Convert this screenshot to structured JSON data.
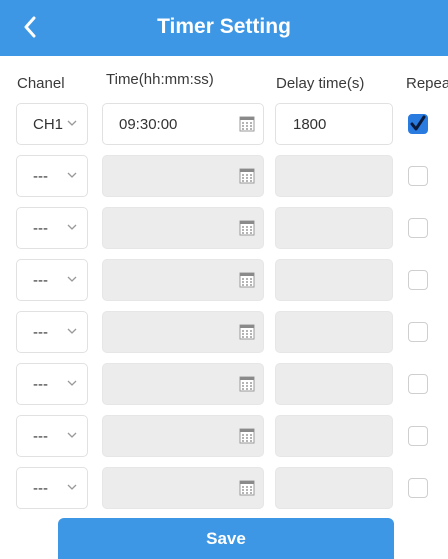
{
  "header": {
    "title": "Timer Setting",
    "back_icon": "chevron-left-icon",
    "color": "#3d97e4"
  },
  "columns": {
    "channel": "Chanel",
    "time": "Time(hh:mm:ss)",
    "delay": "Delay time(s)",
    "repeat": "Repeat"
  },
  "rows": [
    {
      "channel": "CH1",
      "time": "09:30:00",
      "delay": "1800",
      "repeat": true,
      "enabled": true
    },
    {
      "channel": "---",
      "time": "",
      "delay": "",
      "repeat": false,
      "enabled": false
    },
    {
      "channel": "---",
      "time": "",
      "delay": "",
      "repeat": false,
      "enabled": false
    },
    {
      "channel": "---",
      "time": "",
      "delay": "",
      "repeat": false,
      "enabled": false
    },
    {
      "channel": "---",
      "time": "",
      "delay": "",
      "repeat": false,
      "enabled": false
    },
    {
      "channel": "---",
      "time": "",
      "delay": "",
      "repeat": false,
      "enabled": false
    },
    {
      "channel": "---",
      "time": "",
      "delay": "",
      "repeat": false,
      "enabled": false
    },
    {
      "channel": "---",
      "time": "",
      "delay": "",
      "repeat": false,
      "enabled": false
    }
  ],
  "icons": {
    "calendar": "calendar-icon",
    "dropdown": "chevron-down-icon",
    "check": "checkmark-icon"
  },
  "footer": {
    "save_label": "Save"
  }
}
